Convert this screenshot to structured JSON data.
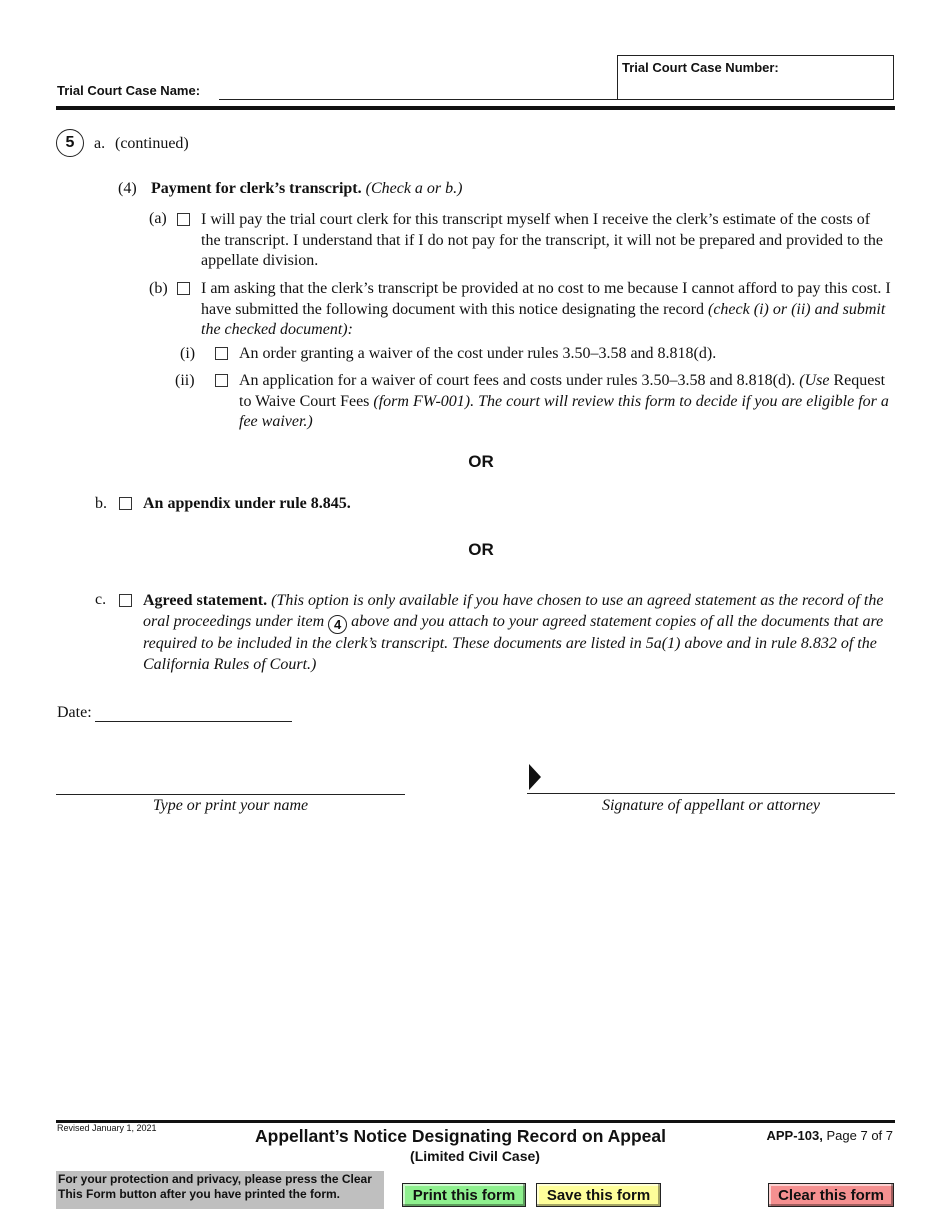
{
  "header": {
    "case_name_label": "Trial Court Case Name:",
    "case_name_value": "",
    "case_number_label": "Trial Court Case Number:",
    "case_number_value": ""
  },
  "section": {
    "number": "5",
    "label": "a.",
    "continued": "(continued)",
    "item4": {
      "number": "(4)",
      "title": "Payment for clerk’s transcript.",
      "instruction": "(Check a or b.)",
      "option_a": {
        "label": "(a)",
        "checked": false,
        "text": "I will pay the trial court clerk for this transcript myself when I receive the clerk’s estimate of the costs of the transcript. I understand that if I do not pay for the transcript, it will not be prepared and provided to the appellate division."
      },
      "option_b": {
        "label": "(b)",
        "checked": false,
        "text": "I am asking that the clerk’s transcript be provided at no cost to me because I cannot afford to pay this cost. I have submitted the following document with this notice designating the record",
        "instruction": "(check (i) or (ii) and submit the checked document):",
        "sub_i": {
          "label": "(i)",
          "checked": false,
          "text": "An order granting a waiver of the cost under rules 3.50–3.58 and 8.818(d)."
        },
        "sub_ii": {
          "label": "(ii)",
          "checked": false,
          "text": "An application for a waiver of court fees and costs under rules 3.50–3.58 and 8.818(d).",
          "note_open": "(Use",
          "note_form": "Request to Waive Court Fees",
          "note_rest": "(form FW-001). The court will review this form to decide if you are eligible for a fee waiver.)"
        }
      }
    },
    "or_1": "OR",
    "option_b": {
      "label": "b.",
      "checked": false,
      "text": "An appendix under rule 8.845."
    },
    "or_2": "OR",
    "option_c": {
      "label": "c.",
      "checked": false,
      "title": "Agreed statement.",
      "note_part1": "(This option is only available if you have chosen to use an agreed statement as the record of the oral proceedings under item",
      "item_ref": "4",
      "note_part2": "above and you attach to your agreed statement copies of all the documents that are required to be included in the clerk’s transcript. These documents are listed in 5a(1) above and in rule 8.832 of the California Rules of Court.)"
    }
  },
  "signature": {
    "date_label": "Date:",
    "date_value": "",
    "name_caption": "Type or print your name",
    "signature_caption": "Signature of appellant or attorney"
  },
  "footer": {
    "revised": "Revised January 1, 2021",
    "title": "Appellant’s Notice Designating Record on Appeal",
    "subtitle": "(Limited Civil Case)",
    "form_id": "APP-103,",
    "page": "Page 7 of 7",
    "privacy_note": "For your protection and privacy, please press the Clear This Form button after you have printed the form.",
    "buttons": {
      "print": "Print this form",
      "save": "Save this form",
      "clear": "Clear this form"
    },
    "colors": {
      "print": "#8ef08e",
      "save": "#fefe9a",
      "clear": "#f59090",
      "privacy_bg": "#bfbfbf"
    }
  }
}
